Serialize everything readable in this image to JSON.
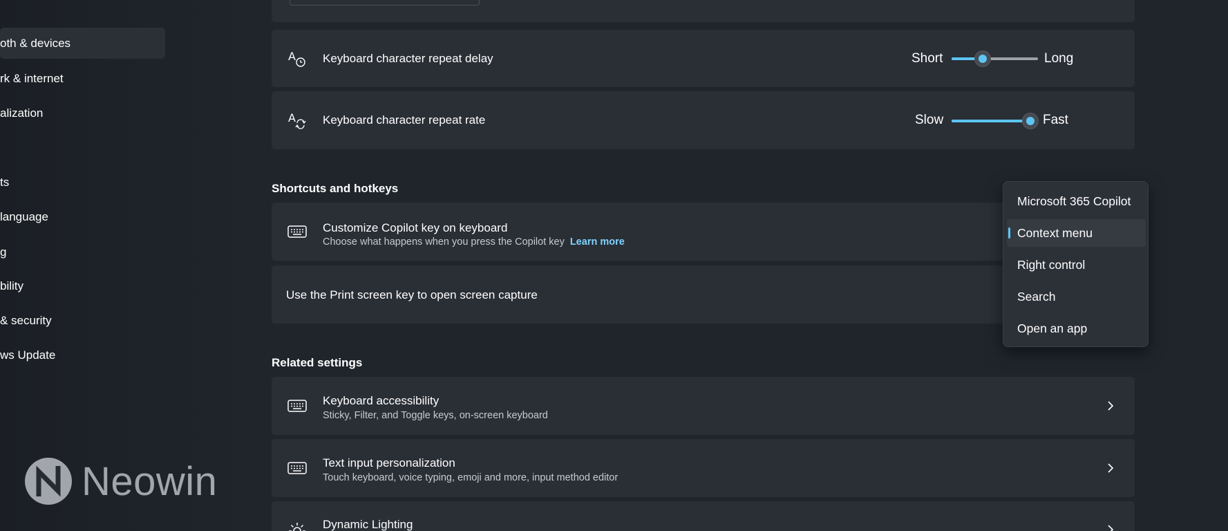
{
  "sidebar": {
    "items": [
      {
        "label": "oth & devices",
        "active": true
      },
      {
        "label": "rk & internet"
      },
      {
        "label": "alization"
      },
      {
        "label": "ts"
      },
      {
        "label": "language"
      },
      {
        "label": "g"
      },
      {
        "label": "bility"
      },
      {
        "label": "& security"
      },
      {
        "label": "ws Update"
      }
    ]
  },
  "settings": {
    "repeat_delay": {
      "title": "Keyboard character repeat delay",
      "min_label": "Short",
      "max_label": "Long",
      "value_fraction": 0.36,
      "icon": "repeat-delay-icon"
    },
    "repeat_rate": {
      "title": "Keyboard character repeat rate",
      "min_label": "Slow",
      "max_label": "Fast",
      "value_fraction": 1.0,
      "icon": "repeat-rate-icon"
    }
  },
  "shortcuts": {
    "section_title": "Shortcuts and hotkeys",
    "copilot": {
      "title": "Customize Copilot key on keyboard",
      "subtitle": "Choose what happens when you press the Copilot key",
      "link": "Learn more",
      "icon": "keyboard-icon"
    },
    "print_screen": {
      "title": "Use the Print screen key to open screen capture"
    }
  },
  "dropdown": {
    "options": [
      {
        "label": "Microsoft 365 Copilot"
      },
      {
        "label": "Context menu",
        "selected": true
      },
      {
        "label": "Right control"
      },
      {
        "label": "Search"
      },
      {
        "label": "Open an app"
      }
    ]
  },
  "related": {
    "section_title": "Related settings",
    "items": [
      {
        "title": "Keyboard accessibility",
        "subtitle": "Sticky, Filter, and Toggle keys, on-screen keyboard",
        "icon": "keyboard-icon"
      },
      {
        "title": "Text input personalization",
        "subtitle": "Touch keyboard, voice typing, emoji and more, input method editor",
        "icon": "keyboard-icon"
      },
      {
        "title": "Dynamic Lighting",
        "icon": "lighting-icon"
      }
    ]
  },
  "watermark": {
    "text": "Neowin"
  },
  "colors": {
    "accent": "#5cc5f4",
    "card": "#2a2e35",
    "background": "#20252c"
  }
}
